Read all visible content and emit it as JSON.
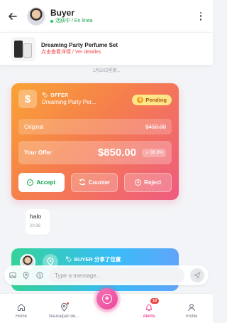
{
  "header": {
    "user_name": "Buyer",
    "status": "活跃中 / En línea"
  },
  "product": {
    "title": "Dreaming Party Perfume Set",
    "link": "点击查看详情 / Ver detalles"
  },
  "date_divider": "1月20日星期...",
  "offer": {
    "label": "OFFER",
    "product_name": "Dreaming Party Per...",
    "status": "Pending",
    "original_label": "Original",
    "original_price": "$450.00",
    "your_offer_label": "Your Offer",
    "your_offer_amount": "$850.00",
    "percent": "88.9%",
    "accept_label": "Accept",
    "counter_label": "Counter",
    "reject_label": "Reject"
  },
  "message": {
    "text": "halo",
    "time": "20:36"
  },
  "location_card": {
    "title": "BUYER 分享了位置"
  },
  "input": {
    "placeholder": "Type a message..."
  },
  "nav": {
    "home": "Home",
    "location": "Naucalpan de...",
    "alerts": "Alerts",
    "alerts_badge": "19",
    "profile": "Profile"
  },
  "colors": {
    "accent": "#ec4899",
    "offer_gradient_start": "#f9a335",
    "offer_gradient_end": "#ee5b80",
    "accept_green": "#16a34a",
    "pending_bg": "#fde68a"
  }
}
